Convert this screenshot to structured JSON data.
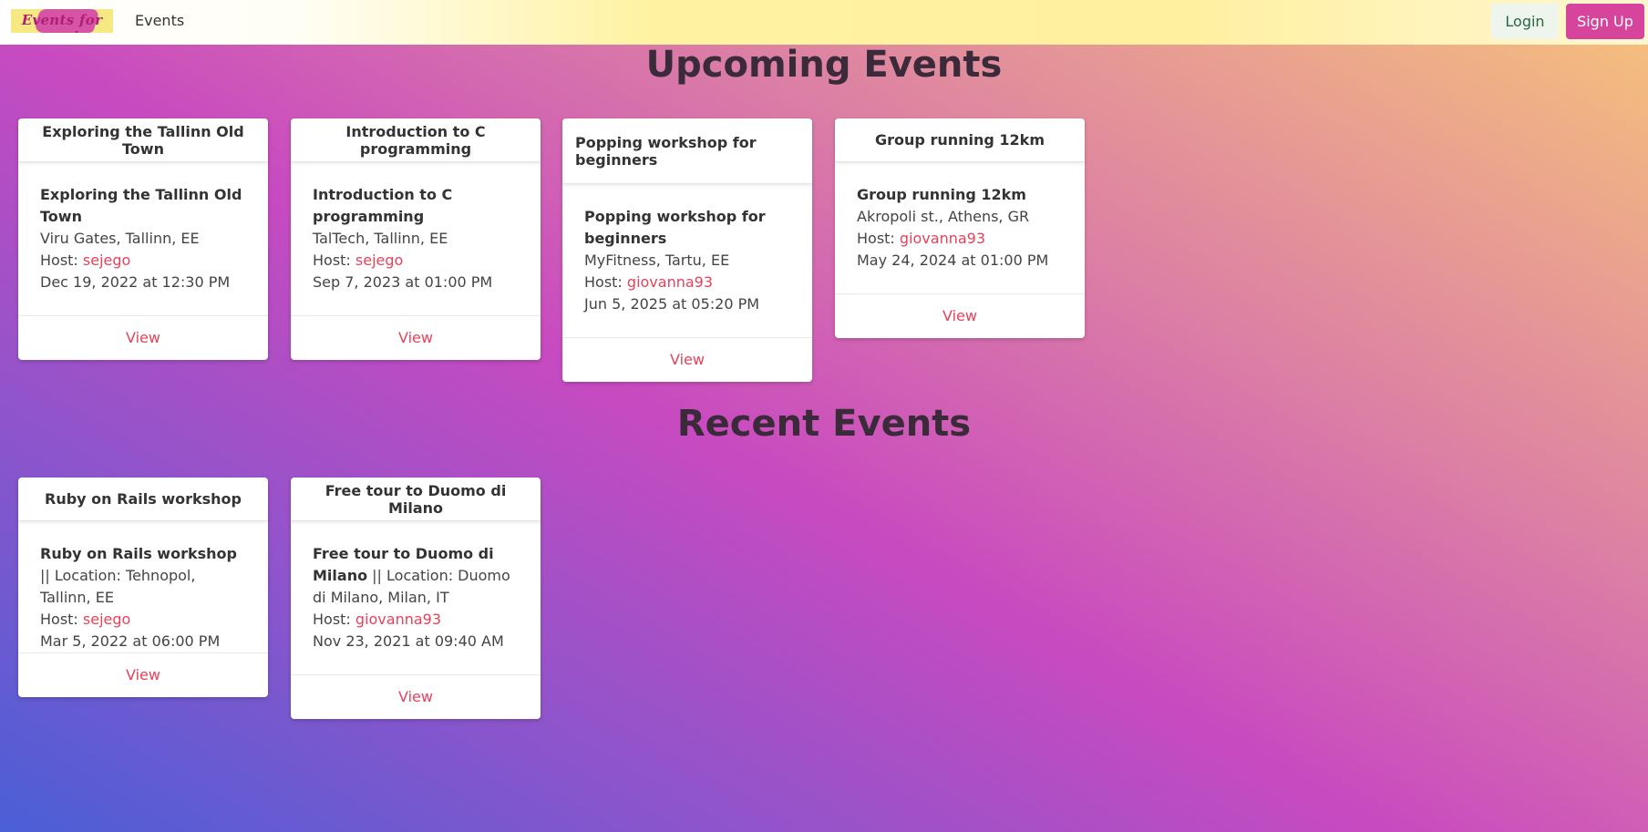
{
  "navbar": {
    "logo_text": "Events for you!",
    "events_link": "Events",
    "login_label": "Login",
    "signup_label": "Sign Up"
  },
  "upcoming": {
    "title": "Upcoming Events",
    "cards": [
      {
        "header": "Exploring the Tallinn Old Town",
        "title": "Exploring the Tallinn Old Town",
        "location": "Viru Gates, Tallinn, EE",
        "host_label": "Host: ",
        "host": "sejego",
        "datetime": "Dec 19, 2022 at 12:30 PM",
        "view_label": "View"
      },
      {
        "header": "Introduction to C programming",
        "title": "Introduction to C programming",
        "location": "TalTech, Tallinn, EE",
        "host_label": "Host: ",
        "host": "sejego",
        "datetime": "Sep 7, 2023 at 01:00 PM",
        "view_label": "View"
      },
      {
        "header": "Popping workshop for beginners",
        "title": "Popping workshop for beginners",
        "location": "MyFitness, Tartu, EE",
        "host_label": "Host: ",
        "host": "giovanna93",
        "datetime": "Jun 5, 2025 at 05:20 PM",
        "view_label": "View"
      },
      {
        "header": "Group running 12km",
        "title": "Group running 12km",
        "location": "Akropoli st., Athens, GR",
        "host_label": "Host: ",
        "host": "giovanna93",
        "datetime": "May 24, 2024 at 01:00 PM",
        "view_label": "View"
      }
    ]
  },
  "recent": {
    "title": "Recent Events",
    "cards": [
      {
        "header": "Ruby on Rails workshop",
        "title": "Ruby on Rails workshop",
        "location": " || Location: Tehnopol, Tallinn, EE",
        "host_label": "Host: ",
        "host": "sejego",
        "datetime": "Mar 5, 2022 at 06:00 PM",
        "view_label": "View"
      },
      {
        "header": "Free tour to Duomo di Milano",
        "title": "Free tour to Duomo di Milano",
        "location": " || Location: Duomo di Milano, Milan, IT",
        "host_label": "Host: ",
        "host": "giovanna93",
        "datetime": "Nov 23, 2021 at 09:40 AM",
        "view_label": "View"
      }
    ]
  }
}
